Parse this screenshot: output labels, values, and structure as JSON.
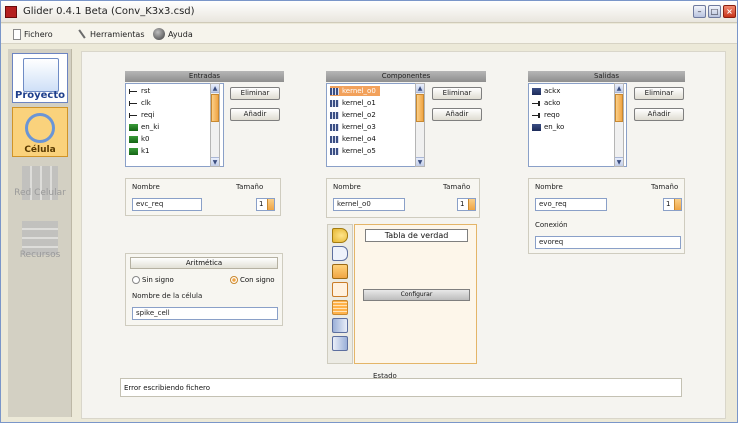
{
  "window": {
    "title": "Glider 0.4.1 Beta (Conv_K3x3.csd)"
  },
  "menu": {
    "file": "Fichero",
    "tools": "Herramientas",
    "help": "Ayuda"
  },
  "nav": {
    "project": "Proyecto",
    "cell": "Célula",
    "network": "Red Celular",
    "resources": "Recursos"
  },
  "inputs": {
    "header": "Entradas",
    "items": [
      {
        "label": "rst",
        "icon": "input-signal-icon"
      },
      {
        "label": "clk",
        "icon": "input-signal-icon"
      },
      {
        "label": "reqi",
        "icon": "input-signal-icon"
      },
      {
        "label": "en_ki",
        "icon": "input-bus-icon"
      },
      {
        "label": "k0",
        "icon": "input-bus-icon"
      },
      {
        "label": "k1",
        "icon": "input-bus-icon"
      }
    ],
    "delete": "Eliminar",
    "add": "Añadir",
    "name_label": "Nombre",
    "size_label": "Tamaño",
    "name_value": "evc_req",
    "size_value": "1"
  },
  "components": {
    "header": "Componentes",
    "items": [
      {
        "label": "kernel_o0",
        "icon": "module-icon"
      },
      {
        "label": "kernel_o1",
        "icon": "module-icon"
      },
      {
        "label": "kernel_o2",
        "icon": "module-icon"
      },
      {
        "label": "kernel_o3",
        "icon": "module-icon"
      },
      {
        "label": "kernel_o4",
        "icon": "module-icon"
      },
      {
        "label": "kernel_o5",
        "icon": "module-icon"
      }
    ],
    "delete": "Eliminar",
    "add": "Añadir",
    "name_label": "Nombre",
    "size_label": "Tamaño",
    "name_value": "kernel_o0",
    "size_value": "1",
    "truth_table": "Tabla de verdad",
    "configure": "Configurar"
  },
  "outputs": {
    "header": "Salidas",
    "items": [
      {
        "label": "ackx",
        "icon": "output-bus-icon"
      },
      {
        "label": "acko",
        "icon": "output-signal-icon"
      },
      {
        "label": "reqo",
        "icon": "output-signal-icon"
      },
      {
        "label": "en_ko",
        "icon": "output-bus-icon"
      }
    ],
    "delete": "Eliminar",
    "add": "Añadir",
    "name_label": "Nombre",
    "size_label": "Tamaño",
    "name_value": "evo_req",
    "size_value": "1",
    "connection_label": "Conexión",
    "connection_value": "evoreq"
  },
  "arithmetic": {
    "title": "Aritmética",
    "unsigned": "Sin signo",
    "signed": "Con signo",
    "cell_name_label": "Nombre de la célula",
    "cell_name_value": "spike_cell"
  },
  "status": {
    "label": "Estado",
    "message": "Error escribiendo fichero"
  }
}
